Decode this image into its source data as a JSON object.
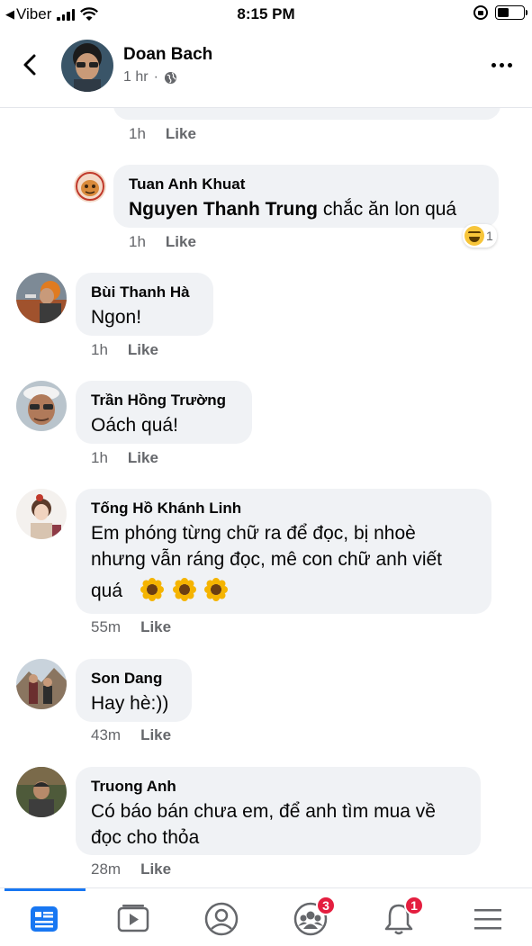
{
  "status_bar": {
    "carrier": "Viber",
    "time": "8:15 PM"
  },
  "header": {
    "name": "Doan Bach",
    "time": "1 hr",
    "separator": "·"
  },
  "comments": [
    {
      "meta_time": "1h",
      "like": "Like"
    },
    {
      "name": "Tuan Anh Khuat",
      "mention": "Nguyen Thanh Trung",
      "text": " chắc ăn lon quá",
      "meta_time": "1h",
      "like": "Like",
      "reaction_count": "1"
    },
    {
      "name": "Bùi Thanh Hà",
      "text": "Ngon!",
      "meta_time": "1h",
      "like": "Like"
    },
    {
      "name": "Trần Hồng Trường",
      "text": "Oách quá!",
      "meta_time": "1h",
      "like": "Like"
    },
    {
      "name": "Tống Hồ Khánh Linh",
      "line1": "Em phóng từng chữ ra để đọc, bị nhoè",
      "line2": "nhưng vẫn ráng đọc, mê con chữ anh viết",
      "line3": "quá",
      "meta_time": "55m",
      "like": "Like"
    },
    {
      "name": "Son Dang",
      "text": "Hay hè:))",
      "meta_time": "43m",
      "like": "Like"
    },
    {
      "name": "Truong Anh",
      "line1": "Có báo bán chưa em, để anh tìm mua về",
      "line2": "đọc cho thỏa",
      "meta_time": "28m",
      "like": "Like"
    }
  ],
  "tabbar": {
    "groups_badge": "3",
    "notifications_badge": "1"
  },
  "colors": {
    "accent": "#1877f2",
    "badge": "#e41e3f",
    "bubble": "#f0f2f5"
  }
}
